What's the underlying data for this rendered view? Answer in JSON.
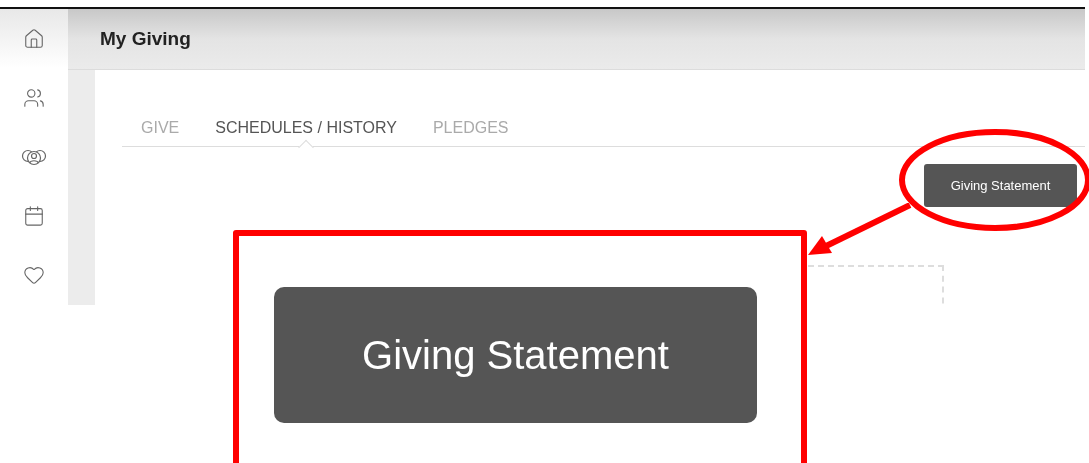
{
  "sidebar": {
    "items": [
      {
        "kind": "home",
        "selected": true
      },
      {
        "kind": "people",
        "selected": false
      },
      {
        "kind": "groups",
        "selected": false
      },
      {
        "kind": "calendar",
        "selected": false
      },
      {
        "kind": "heart",
        "selected": false
      }
    ]
  },
  "page_title": "My Giving",
  "tabs": [
    {
      "label": "GIVE",
      "selected": false
    },
    {
      "label": "SCHEDULES / HISTORY",
      "selected": true
    },
    {
      "label": "PLEDGES",
      "selected": false
    }
  ],
  "statement_button": "Giving Statement",
  "callout": {
    "button_label": "Giving Statement"
  }
}
